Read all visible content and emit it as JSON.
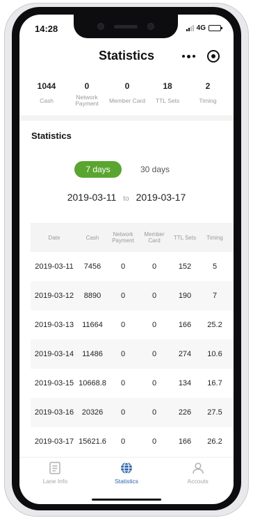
{
  "status_bar": {
    "time": "14:28",
    "network": "4G"
  },
  "nav": {
    "title": "Statistics"
  },
  "summary": [
    {
      "value": "1044",
      "label": "Cash"
    },
    {
      "value": "0",
      "label": "Network Payment"
    },
    {
      "value": "0",
      "label": "Member Card"
    },
    {
      "value": "18",
      "label": "TTL Sets"
    },
    {
      "value": "2",
      "label": "Timing"
    }
  ],
  "section": {
    "title": "Statistics"
  },
  "range": {
    "tabs": [
      {
        "label": "7 days",
        "active": true
      },
      {
        "label": "30 days",
        "active": false
      }
    ],
    "start_date": "2019-03-11",
    "to_label": "to",
    "end_date": "2019-03-17"
  },
  "table": {
    "headers": [
      "Date",
      "Cash",
      "Network Payment",
      "Member Card",
      "TTL Sets",
      "Timing"
    ],
    "rows": [
      [
        "2019-03-11",
        "7456",
        "0",
        "0",
        "152",
        "5"
      ],
      [
        "2019-03-12",
        "8890",
        "0",
        "0",
        "190",
        "7"
      ],
      [
        "2019-03-13",
        "11664",
        "0",
        "0",
        "166",
        "25.2"
      ],
      [
        "2019-03-14",
        "11486",
        "0",
        "0",
        "274",
        "10.6"
      ],
      [
        "2019-03-15",
        "10668.8",
        "0",
        "0",
        "134",
        "16.7"
      ],
      [
        "2019-03-16",
        "20326",
        "0",
        "0",
        "226",
        "27.5"
      ],
      [
        "2019-03-17",
        "15621.6",
        "0",
        "0",
        "166",
        "26.2"
      ]
    ]
  },
  "tab_bar": [
    {
      "label": "Lane Info",
      "icon": "lane-info-icon",
      "active": false
    },
    {
      "label": "Statistics",
      "icon": "globe-icon",
      "active": true
    },
    {
      "label": "Accouts",
      "icon": "user-icon",
      "active": false
    }
  ],
  "colors": {
    "accent_green": "#5aa52f",
    "active_tab_blue": "#2c64a8"
  }
}
